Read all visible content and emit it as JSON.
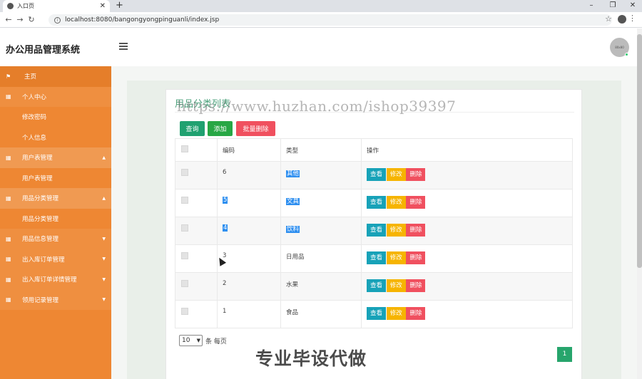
{
  "browser": {
    "tab_title": "入口页",
    "url": "localhost:8080/bangongyongpinguanli/index.jsp"
  },
  "header": {
    "app_title": "办公用品管理系统",
    "avatar_text": "80x80"
  },
  "sidebar": {
    "items": [
      {
        "label": "主页",
        "kind": "home"
      },
      {
        "label": "个人中心",
        "kind": "parent"
      },
      {
        "label": "修改密码",
        "kind": "child"
      },
      {
        "label": "个人信息",
        "kind": "child"
      },
      {
        "label": "用户表管理",
        "kind": "parent-open"
      },
      {
        "label": "用户表管理",
        "kind": "child"
      },
      {
        "label": "用品分类管理",
        "kind": "parent-open"
      },
      {
        "label": "用品分类管理",
        "kind": "child"
      },
      {
        "label": "用品信息管理",
        "kind": "parent"
      },
      {
        "label": "出入库订单管理",
        "kind": "parent"
      },
      {
        "label": "出入库订单详情管理",
        "kind": "parent"
      },
      {
        "label": "领用记录管理",
        "kind": "parent"
      }
    ]
  },
  "panel": {
    "title": "用品分类列表",
    "btn_query": "查询",
    "btn_add": "添加",
    "btn_batch_delete": "批量删除"
  },
  "table": {
    "headers": {
      "code": "编码",
      "type": "类型",
      "ops": "操作"
    },
    "rows": [
      {
        "code": "6",
        "type": "其他"
      },
      {
        "code": "5",
        "type": "文具"
      },
      {
        "code": "4",
        "type": "饮料"
      },
      {
        "code": "3",
        "type": "日用品"
      },
      {
        "code": "2",
        "type": "水果"
      },
      {
        "code": "1",
        "type": "食品"
      }
    ],
    "op_view": "查看",
    "op_edit": "修改",
    "op_delete": "删除"
  },
  "pagination": {
    "page_size": "10",
    "per_page_label": "条 每页",
    "current_page": "1"
  },
  "overlays": {
    "watermark_url": "https://www.huzhan.com/ishop39397",
    "watermark_cn": "专业毕设代做"
  },
  "colors": {
    "sidebar": "#ee8733",
    "accent_green": "#20a170",
    "danger": "#f0505f",
    "info": "#17a2b8",
    "warning": "#f6b400"
  }
}
